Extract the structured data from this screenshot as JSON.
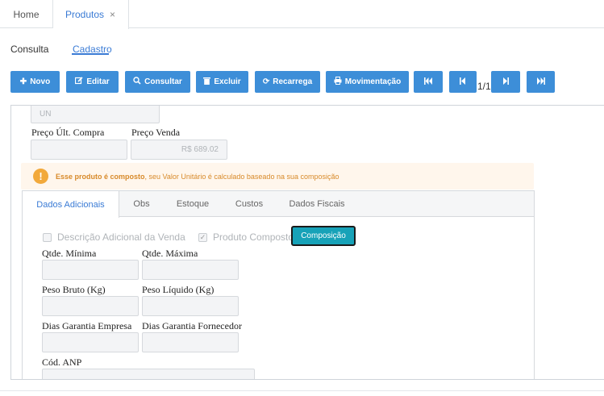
{
  "top_tabs": {
    "home": "Home",
    "produtos": "Produtos",
    "close_glyph": "×"
  },
  "sub_tabs": {
    "consulta": "Consulta",
    "cadastro": "Cadastro"
  },
  "toolbar": {
    "novo": "Novo",
    "editar": "Editar",
    "consultar": "Consultar",
    "excluir": "Excluir",
    "recarrega": "Recarrega",
    "movimentacao": "Movimentação",
    "page_indicator": "1/1"
  },
  "form": {
    "unidade_value": "UN",
    "preco_ult_compra_label": "Preço Últ. Compra",
    "preco_ult_compra_value": "",
    "preco_venda_label": "Preço Venda",
    "preco_venda_value": "R$ 689.02"
  },
  "notice": {
    "bold": "Esse produto é composto",
    "rest": ", seu Valor Unitário é calculado baseado na sua composição"
  },
  "inner_tabs": [
    "Dados Adicionais",
    "Obs",
    "Estoque",
    "Custos",
    "Dados Fiscais"
  ],
  "dados_adicionais": {
    "descricao_adicional_label": "Descrição Adicional da Venda",
    "descricao_adicional_checked": false,
    "produto_composto_label": "Produto Composto",
    "produto_composto_checked": true,
    "composicao_button": "Composição",
    "qtde_minima_label": "Qtde. Mínima",
    "qtde_maxima_label": "Qtde. Máxima",
    "peso_bruto_label": "Peso Bruto (Kg)",
    "peso_liquido_label": "Peso Líquido (Kg)",
    "dias_garantia_empresa_label": "Dias Garantia Empresa",
    "dias_garantia_fornecedor_label": "Dias Garantia Fornecedor",
    "cod_anp_label": "Cód. ANP"
  },
  "colors": {
    "primary": "#3d8ed8",
    "accent_tab": "#3a7bd5",
    "composicao": "#17a2b8",
    "warning": "#f2a93b",
    "warning_text": "#d88a2a"
  }
}
